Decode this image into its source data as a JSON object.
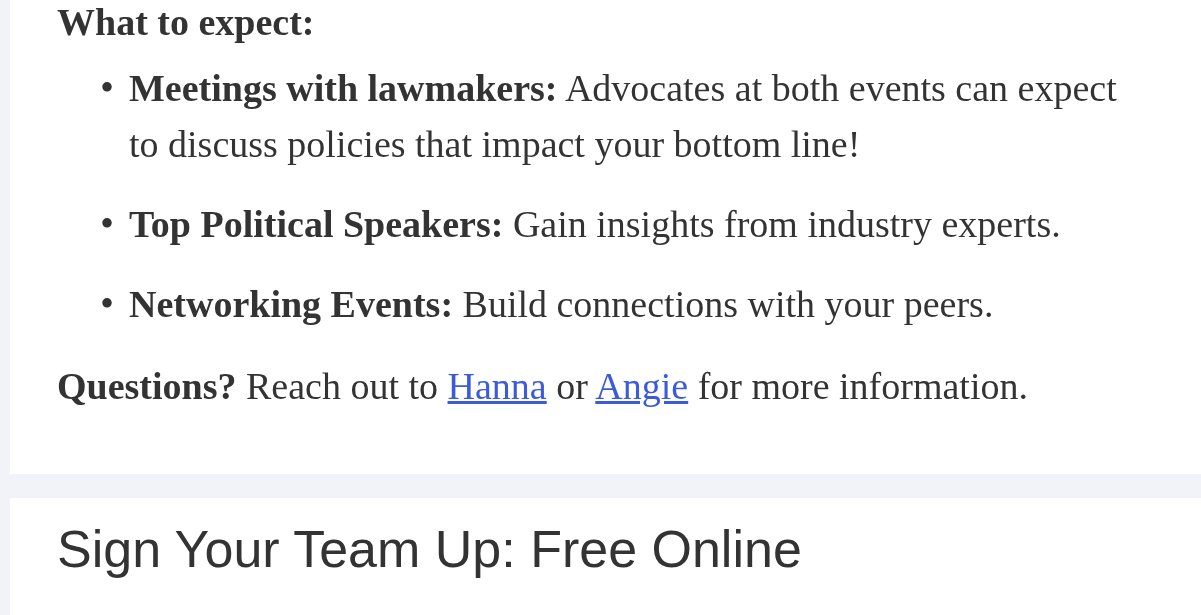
{
  "section_heading": "What to expect:",
  "items": [
    {
      "marker": "•",
      "term": "Meetings with lawmakers:",
      "text": "Advocates at both events can expect to discuss policies that impact your bottom line!"
    },
    {
      "marker": "•",
      "term": "Top Political Speakers:",
      "text": "Gain insights from industry experts."
    },
    {
      "marker": "•",
      "term": "Networking Events:",
      "text": "Build connections with your peers."
    }
  ],
  "questions": {
    "label": "Questions?",
    "before": "Reach out to",
    "links": [
      "Hanna",
      "Angie"
    ],
    "between": "or",
    "after": "for more information."
  },
  "next_heading": "Sign Your Team Up: Free Online"
}
